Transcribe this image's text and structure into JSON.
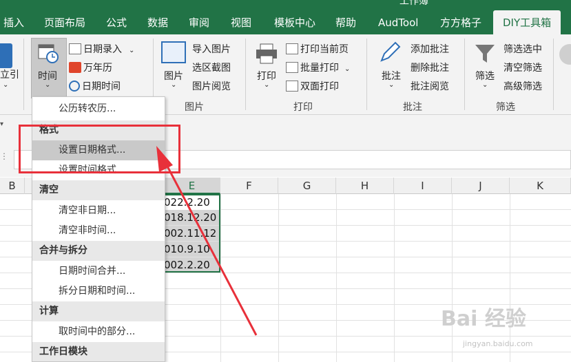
{
  "window": {
    "title": "工作簿"
  },
  "tabs": [
    "插入",
    "页面布局",
    "公式",
    "数据",
    "审阅",
    "视图",
    "模板中心",
    "帮助",
    "AudTool",
    "方方格子",
    "DIY工具箱"
  ],
  "ribbon": {
    "left_cut": "立引",
    "date_group": {
      "time_button": "时间",
      "date_entry": "日期录入",
      "calendar": "万年历",
      "datetime": "日期时间"
    },
    "picture_group": {
      "picture_button": "图片",
      "import": "导入图片",
      "region_capture": "选区截图",
      "browse": "图片阅览",
      "label": "图片"
    },
    "print_group": {
      "print_button": "打印",
      "print_current": "打印当前页",
      "batch_print": "批量打印",
      "duplex_print": "双面打印",
      "label": "打印"
    },
    "comment_group": {
      "comment_button": "批注",
      "add": "添加批注",
      "delete": "删除批注",
      "browse": "批注阅览",
      "label": "批注"
    },
    "filter_group": {
      "filter_button": "筛选",
      "filter_selected": "筛选选中",
      "clear": "清空筛选",
      "advanced": "高级筛选",
      "label": "筛选"
    }
  },
  "columns": [
    "B",
    "E",
    "F",
    "G",
    "H",
    "I",
    "J",
    "K"
  ],
  "cells": [
    "022.2.20",
    "018.12.20",
    "002.11.12",
    "010.9.10",
    "002.2.20"
  ],
  "menu": [
    {
      "kind": "item",
      "label": "公历转农历..."
    },
    {
      "kind": "header",
      "label": "格式"
    },
    {
      "kind": "item",
      "label": "设置日期格式...",
      "highlighted": true
    },
    {
      "kind": "item",
      "label": "设置时间格式..."
    },
    {
      "kind": "header",
      "label": "清空"
    },
    {
      "kind": "item",
      "label": "清空非日期..."
    },
    {
      "kind": "item",
      "label": "清空非时间..."
    },
    {
      "kind": "header",
      "label": "合并与拆分"
    },
    {
      "kind": "item",
      "label": "日期时间合并..."
    },
    {
      "kind": "item",
      "label": "拆分日期和时间..."
    },
    {
      "kind": "header",
      "label": "计算"
    },
    {
      "kind": "item",
      "label": "取时间中的部分..."
    },
    {
      "kind": "header",
      "label": "工作日模块"
    }
  ],
  "colors": {
    "excel_green": "#217346",
    "highlight_red": "#e8303a"
  },
  "watermark": {
    "main": "Bai 经验",
    "sub": "jingyan.baidu.com"
  }
}
